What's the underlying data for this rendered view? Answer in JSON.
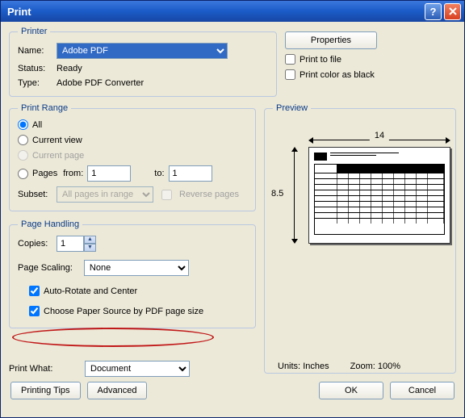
{
  "window": {
    "title": "Print"
  },
  "printer": {
    "legend": "Printer",
    "name_label": "Name:",
    "name_value": "Adobe PDF",
    "status_label": "Status:",
    "status_value": "Ready",
    "type_label": "Type:",
    "type_value": "Adobe PDF Converter",
    "properties_button": "Properties",
    "print_to_file": "Print to file",
    "print_color_black": "Print color as black"
  },
  "range": {
    "legend": "Print Range",
    "all": "All",
    "current_view": "Current view",
    "current_page": "Current page",
    "pages": "Pages",
    "from": "from:",
    "to": "to:",
    "from_value": "1",
    "to_value": "1",
    "subset_label": "Subset:",
    "subset_value": "All pages in range",
    "reverse_pages": "Reverse pages"
  },
  "handling": {
    "legend": "Page Handling",
    "copies_label": "Copies:",
    "copies_value": "1",
    "scaling_label": "Page Scaling:",
    "scaling_value": "None",
    "auto_rotate": "Auto-Rotate and Center",
    "choose_paper": "Choose Paper Source by PDF page size"
  },
  "print_what": {
    "label": "Print What:",
    "value": "Document"
  },
  "preview": {
    "legend": "Preview",
    "width": "14",
    "height": "8.5",
    "units_label": "Units:",
    "units_value": "Inches",
    "zoom_label": "Zoom:",
    "zoom_value": "100%"
  },
  "footer": {
    "printing_tips": "Printing Tips",
    "advanced": "Advanced",
    "ok": "OK",
    "cancel": "Cancel"
  }
}
